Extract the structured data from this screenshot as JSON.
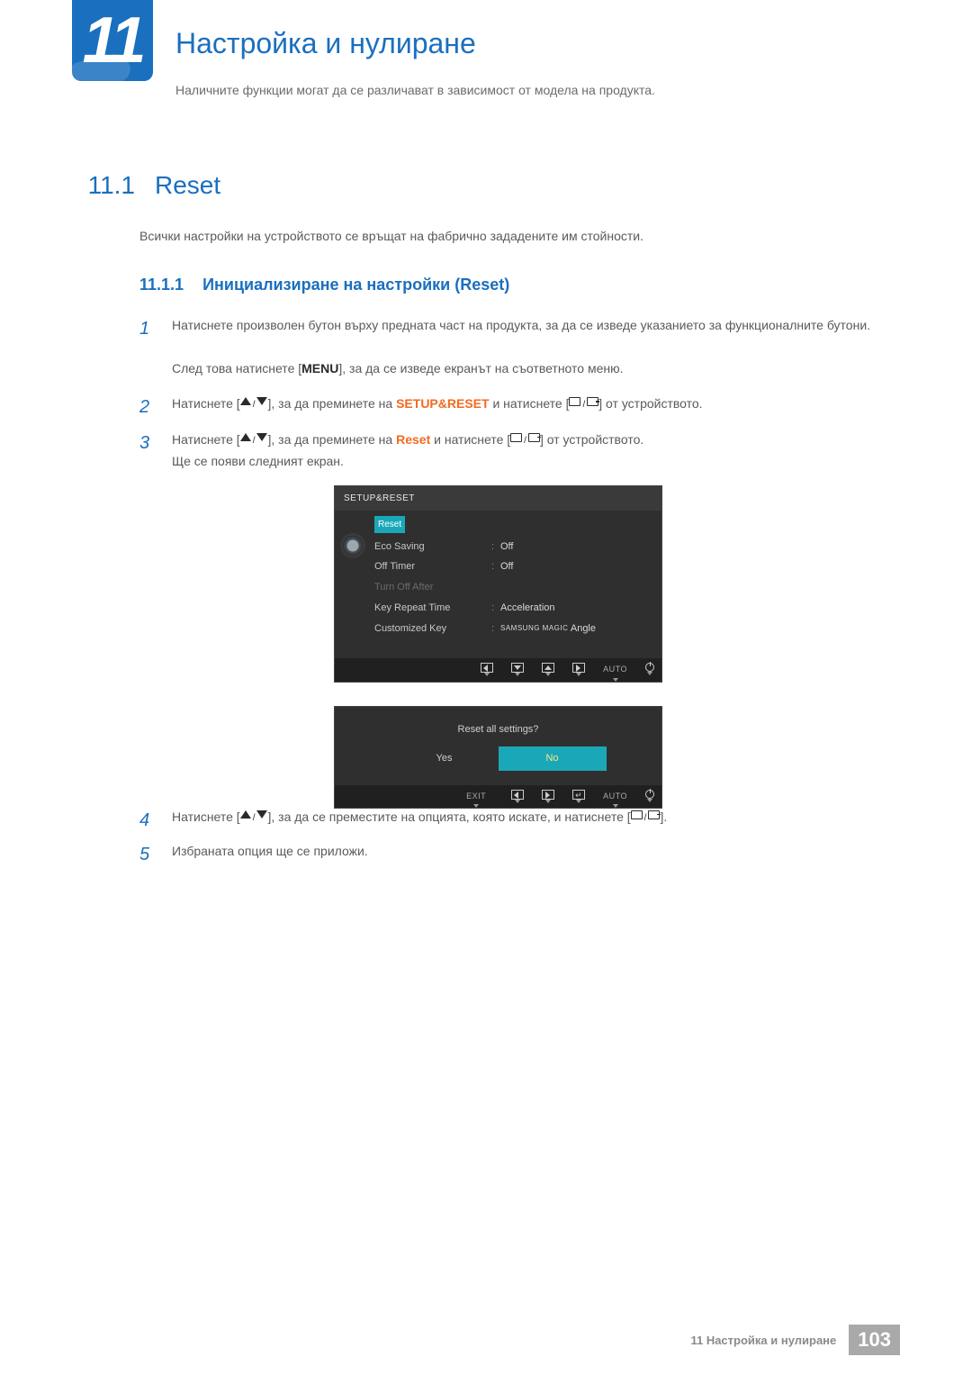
{
  "chapter": {
    "number": "11",
    "title": "Настройка и нулиране",
    "subtitle": "Наличните функции могат да се различават в зависимост от модела на продукта."
  },
  "section": {
    "number": "11.1",
    "title": "Reset",
    "intro": "Всички настройки на устройството се връщат на фабрично зададените им стойности."
  },
  "subsection": {
    "number": "11.1.1",
    "title": "Инициализиране на настройки (Reset)"
  },
  "steps": {
    "s1a": "Натиснете произволен бутон върху предната част на продукта, за да се изведе указанието за функционалните бутони.",
    "s1b_pre": "След това натиснете [",
    "s1b_menu": "MENU",
    "s1b_post": "], за да се изведе екранът на съответното меню.",
    "s2_pre": "Натиснете [",
    "s2_mid": "], за да преминете на ",
    "s2_target": "SETUP&RESET",
    "s2_mid2": " и натиснете [",
    "s2_post": "] от устройството.",
    "s3_pre": "Натиснете [",
    "s3_mid": "], за да преминете на ",
    "s3_target": "Reset",
    "s3_mid2": " и натиснете [",
    "s3_post": "] от устройството.",
    "s3_after": "Ще се появи следният екран.",
    "s4_pre": "Натиснете [",
    "s4_mid": "], за да се преместите на опцията, която искате, и натиснете [",
    "s4_post": "].",
    "s5": "Избраната опция ще се приложи."
  },
  "osd1": {
    "title": "SETUP&RESET",
    "selected": "Reset",
    "rows": [
      {
        "label": "Eco Saving",
        "value": "Off",
        "dim": false
      },
      {
        "label": "Off Timer",
        "value": "Off",
        "dim": false
      },
      {
        "label": "Turn Off After",
        "value": "",
        "dim": true
      },
      {
        "label": "Key Repeat Time",
        "value": "Acceleration",
        "dim": false
      },
      {
        "label": "Customized Key",
        "value": "Angle",
        "dim": false,
        "magic": "SAMSUNG\nMAGIC"
      }
    ],
    "foot_auto": "AUTO"
  },
  "osd2": {
    "question": "Reset all settings?",
    "yes": "Yes",
    "no": "No",
    "exit": "EXIT",
    "auto": "AUTO"
  },
  "footer": {
    "crumb_num": "11",
    "crumb_text": "Настройка и нулиране",
    "page": "103"
  }
}
